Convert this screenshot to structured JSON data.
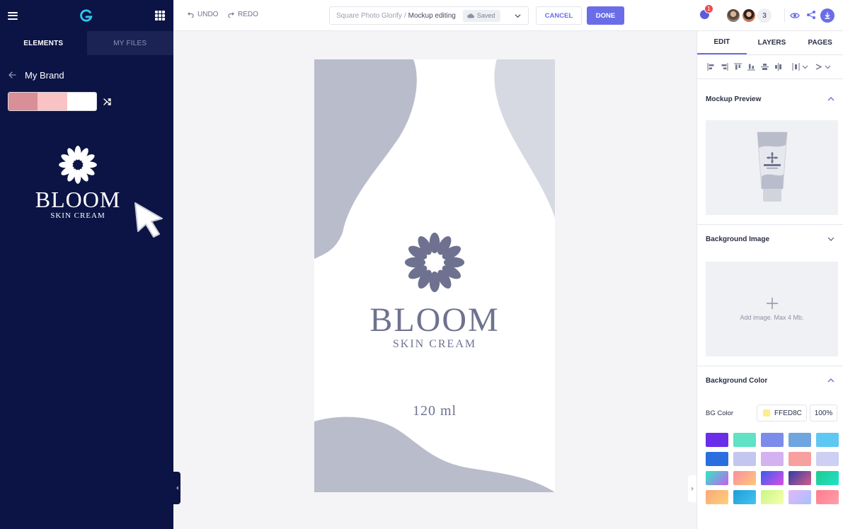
{
  "left_panel": {
    "tabs": [
      {
        "label": "ELEMENTS",
        "active": true
      },
      {
        "label": "MY FILES",
        "active": false
      }
    ],
    "brand_title": "My Brand",
    "palette_colors": [
      "#d88f97",
      "#f9c3c5",
      "#ffffff"
    ],
    "brand_logo": {
      "word": "BLOOM",
      "subtitle": "SKIN CREAM"
    }
  },
  "toolbar": {
    "undo_label": "UNDO",
    "redo_label": "REDO",
    "doc_path": "Square Photo Glorify",
    "doc_separator": "/",
    "doc_name": "Mockup editing",
    "saved_label": "Saved",
    "cancel_label": "CANCEL",
    "done_label": "DONE",
    "notification_count": "1",
    "collaborator_count": "3",
    "accent_color": "#6b6de8"
  },
  "canvas": {
    "logo_word": "BLOOM",
    "logo_subtitle": "SKIN CREAM",
    "volume_text": "120 ml",
    "shape_color": "#b9bccb",
    "text_color": "#6e7290"
  },
  "right_panel": {
    "tabs": [
      {
        "label": "EDIT",
        "active": true
      },
      {
        "label": "LAYERS",
        "active": false
      },
      {
        "label": "PAGES",
        "active": false
      }
    ],
    "sections": {
      "mockup_preview": {
        "title": "Mockup Preview",
        "expanded": true
      },
      "background_image": {
        "title": "Background Image",
        "expanded": false,
        "hint": "Add image. Max 4 Mb."
      },
      "background_color": {
        "title": "Background Color",
        "expanded": true,
        "label": "BG Color",
        "hex": "FFED8C",
        "opacity": "100%",
        "swatch_color": "#ffed8c"
      }
    },
    "swatches": [
      "#6a2ee8",
      "#5fe3c4",
      "#7b8cea",
      "#6fa6df",
      "#5ec8f2",
      "#2a6fe0",
      "#c3c6ee",
      "#d4b2f0",
      "#f7a09e",
      "#cdd0f2",
      "linear-gradient(135deg,#2ee9c4,#c85ef0)",
      "linear-gradient(135deg,#f98fa0,#ffc67a)",
      "linear-gradient(135deg,#3b5cf0,#d94fe2)",
      "linear-gradient(135deg,#2e3ea8,#d75a86)",
      "linear-gradient(135deg,#1fc98f,#21e2c9)",
      "linear-gradient(135deg,#f8a77a,#ffd07a)",
      "linear-gradient(135deg,#1e9ed8,#46c2f0)",
      "linear-gradient(135deg,#c9f58a,#f7ffa8)",
      "linear-gradient(135deg,#e3b7f7,#a7c0ff)",
      "linear-gradient(135deg,#ff7b8e,#ff9fa8)"
    ]
  }
}
